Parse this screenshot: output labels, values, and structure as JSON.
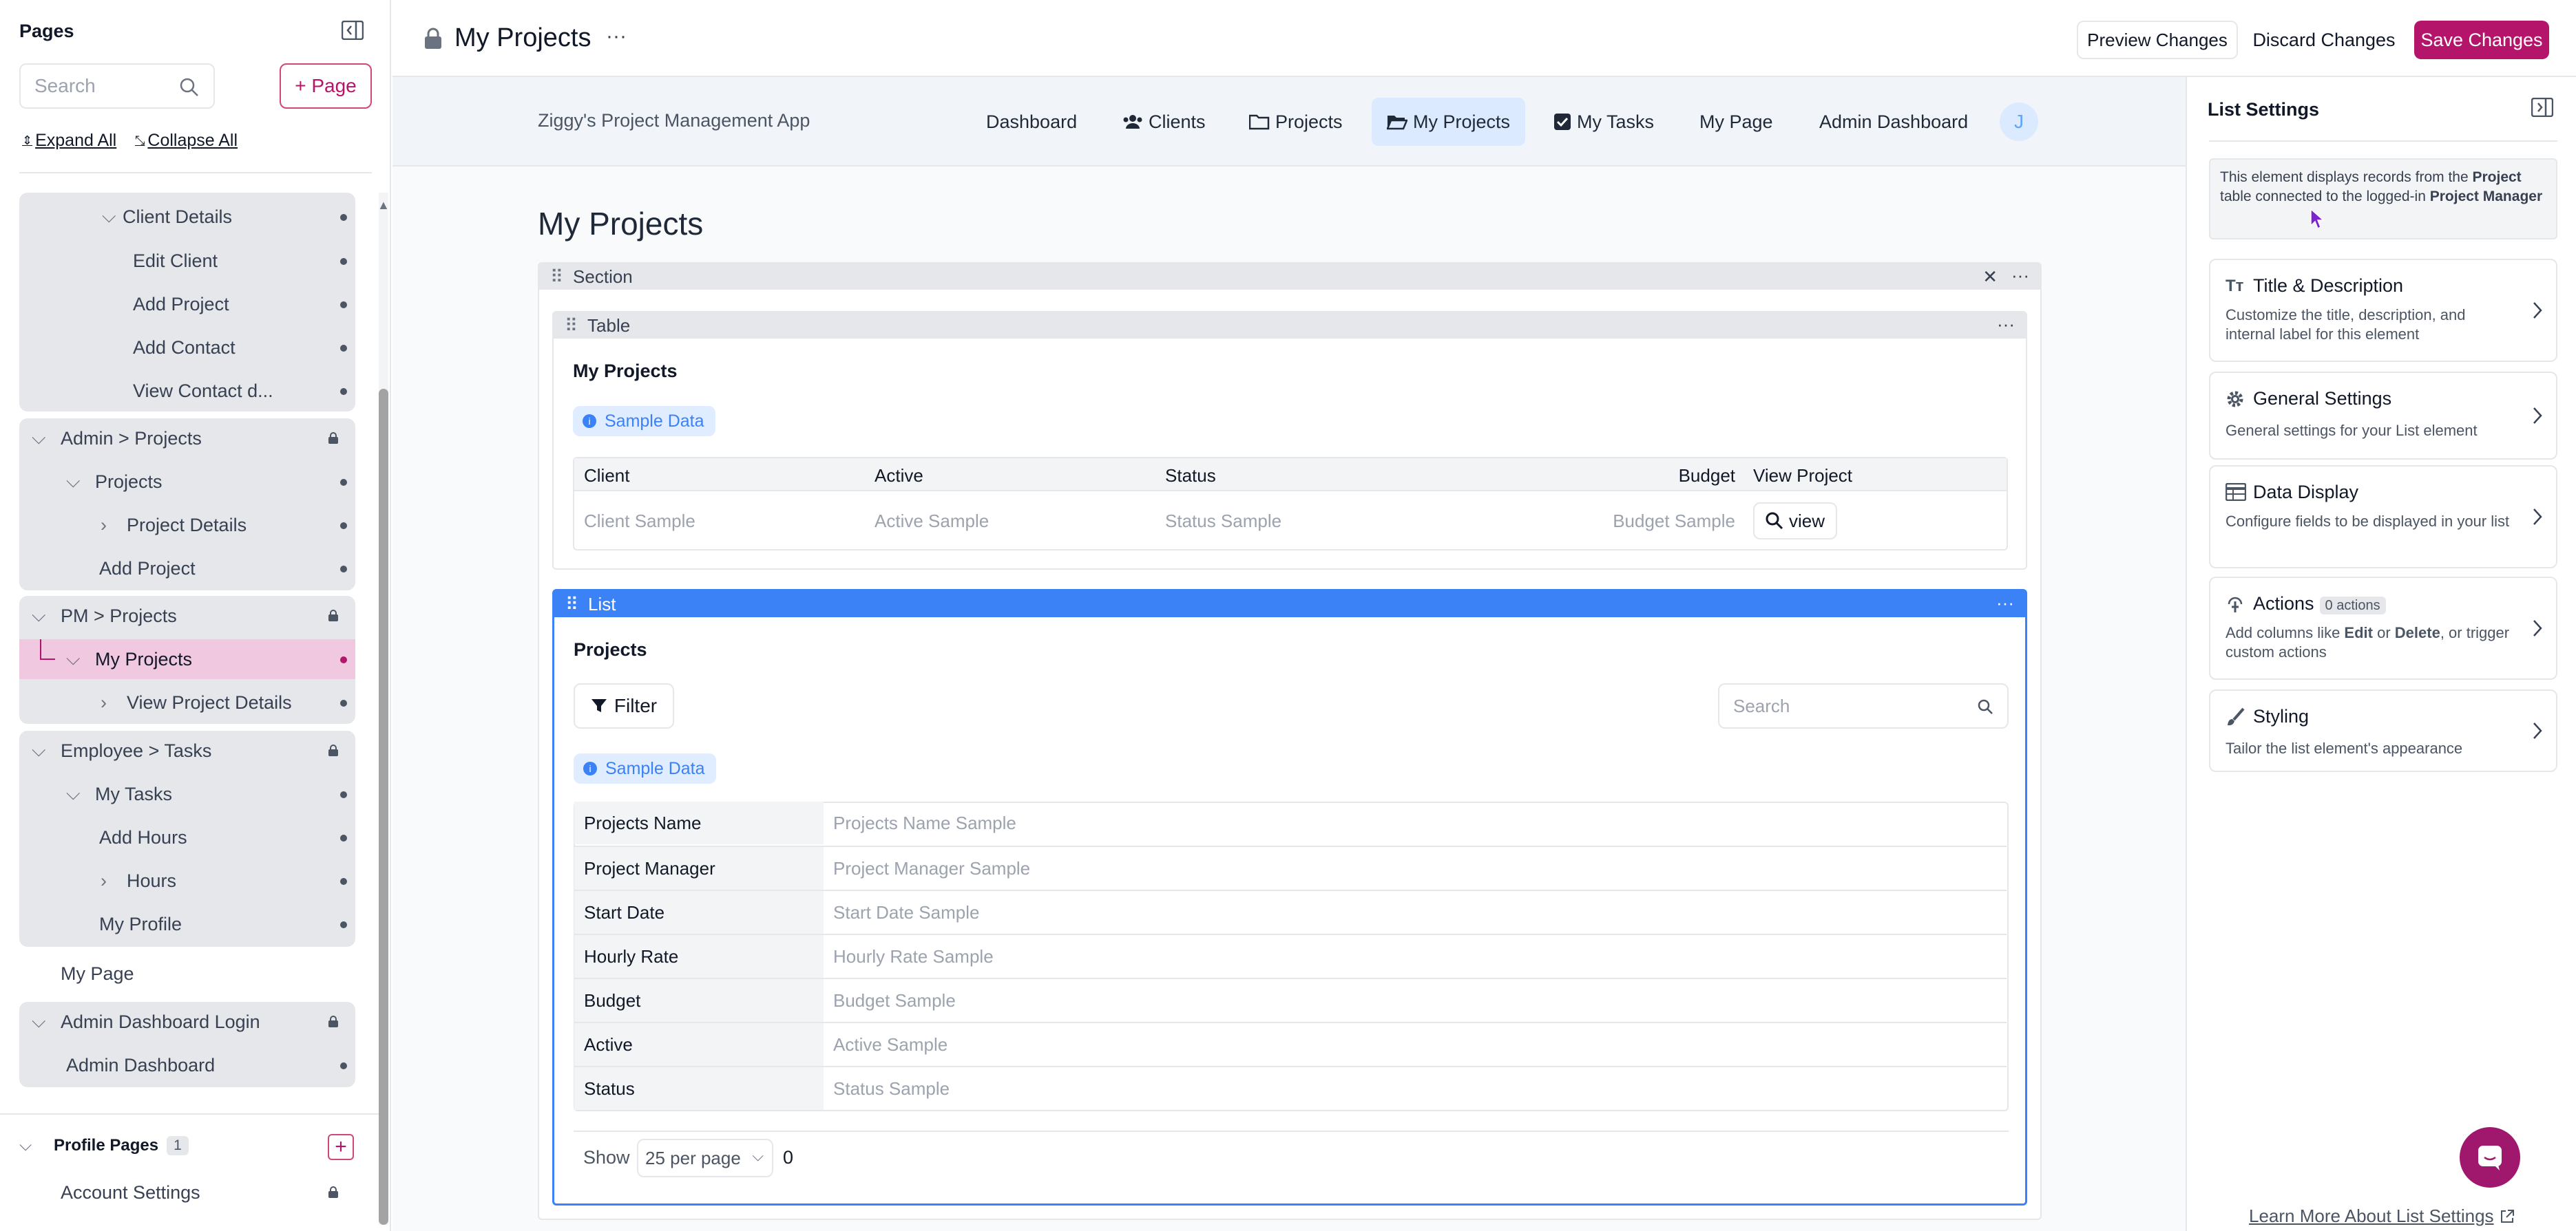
{
  "topbar": {
    "page_title": "My Projects",
    "more_label": "···",
    "preview_label": "Preview Changes",
    "discard_label": "Discard Changes",
    "save_label": "Save Changes"
  },
  "left_sidebar": {
    "title": "Pages",
    "search_placeholder": "Search",
    "add_page_label": "+ Page",
    "expand_all": "Expand All",
    "collapse_all": "Collapse All",
    "tree": {
      "client_details": "Client Details",
      "edit_client": "Edit Client",
      "add_project": "Add Project",
      "add_contact": "Add Contact",
      "view_contact": "View Contact d...",
      "admin_projects": "Admin > Projects",
      "projects": "Projects",
      "project_details": "Project Details",
      "add_project_2": "Add Project",
      "pm_projects": "PM > Projects",
      "my_projects": "My Projects",
      "view_project_details": "View Project Details",
      "employee_tasks": "Employee > Tasks",
      "my_tasks": "My Tasks",
      "add_hours": "Add Hours",
      "hours": "Hours",
      "my_profile": "My Profile",
      "my_page": "My Page",
      "admin_dashboard_login": "Admin Dashboard Login",
      "admin_dashboard": "Admin Dashboard"
    },
    "profile_pages": {
      "label": "Profile Pages",
      "count": "1",
      "account_settings": "Account Settings"
    }
  },
  "app_nav": {
    "app_name": "Ziggy's Project Management App",
    "items": [
      "Dashboard",
      "Clients",
      "Projects",
      "My Projects",
      "My Tasks",
      "My Page",
      "Admin Dashboard"
    ],
    "avatar_letter": "J"
  },
  "canvas": {
    "page_heading": "My Projects",
    "section_label": "Section",
    "table_block": {
      "label": "Table",
      "title": "My Projects",
      "sample_badge": "Sample Data",
      "columns": [
        "Client",
        "Active",
        "Status",
        "Budget",
        "View Project"
      ],
      "row": [
        "Client Sample",
        "Active Sample",
        "Status Sample",
        "Budget Sample"
      ],
      "view_button": "view"
    },
    "list_block": {
      "label": "List",
      "title": "Projects",
      "filter_label": "Filter",
      "search_placeholder": "Search",
      "sample_badge": "Sample Data",
      "rows": [
        {
          "k": "Projects Name",
          "v": "Projects Name Sample"
        },
        {
          "k": "Project Manager",
          "v": "Project Manager Sample"
        },
        {
          "k": "Start Date",
          "v": "Start Date Sample"
        },
        {
          "k": "Hourly Rate",
          "v": "Hourly Rate Sample"
        },
        {
          "k": "Budget",
          "v": "Budget Sample"
        },
        {
          "k": "Active",
          "v": "Active Sample"
        },
        {
          "k": "Status",
          "v": "Status Sample"
        }
      ],
      "show_label": "Show",
      "per_page": "25 per page",
      "count": "0"
    }
  },
  "right_panel": {
    "title": "List Settings",
    "info": {
      "part1": "This element displays records from the ",
      "bold1": "Project",
      "part2": " table connected to the logged-in ",
      "bold2": "Project Manager"
    },
    "cards": {
      "title_desc": {
        "title": "Title & Description",
        "desc": "Customize the title, description, and internal label for this element"
      },
      "general": {
        "title": "General Settings",
        "desc": "General settings for your List element"
      },
      "data_display": {
        "title": "Data Display",
        "desc": "Configure fields to be displayed in your list"
      },
      "actions": {
        "title": "Actions",
        "badge": "0 actions",
        "desc_a": "Add columns like ",
        "desc_b": "Edit",
        "desc_c": " or ",
        "desc_d": "Delete",
        "desc_e": ", or trigger custom actions"
      },
      "styling": {
        "title": "Styling",
        "desc": "Tailor the list element's appearance"
      }
    },
    "learn_more": "Learn More About List Settings"
  },
  "colors": {
    "brand": "#b5146b",
    "list_blue": "#3b82f6",
    "active_nav": "#dbeafe",
    "selected_page": "#f0c8e0"
  }
}
